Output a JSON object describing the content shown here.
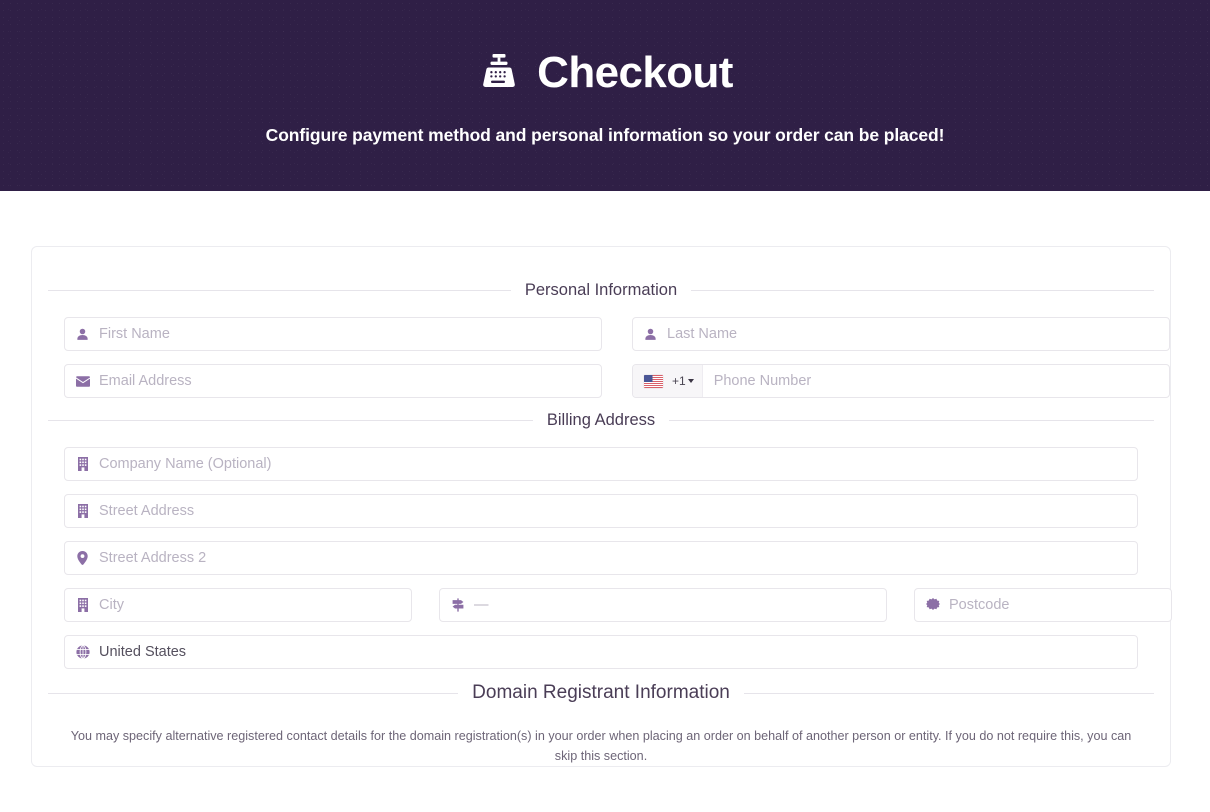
{
  "header": {
    "icon": "cash-register-icon",
    "title": "Checkout",
    "subtitle": "Configure payment method and personal information so your order can be placed!",
    "bg_color": "#2f1f46",
    "text_color": "#ffffff"
  },
  "theme": {
    "icon_color": "#8c6fa6",
    "placeholder_color": "#b9b3c2",
    "value_color": "#55505e",
    "border_color": "#e8e6eb",
    "legend_color": "#4a3d56"
  },
  "sections": {
    "personal_information": {
      "legend": "Personal Information",
      "fields": {
        "first_name": {
          "placeholder": "First Name",
          "icon": "user-icon",
          "value": ""
        },
        "last_name": {
          "placeholder": "Last Name",
          "icon": "user-icon",
          "value": ""
        },
        "email": {
          "placeholder": "Email Address",
          "icon": "envelope-icon",
          "value": ""
        },
        "phone": {
          "placeholder": "Phone Number",
          "icon": "us-flag-icon",
          "dial_code": "+1",
          "country_code": "US",
          "value": ""
        }
      }
    },
    "billing_address": {
      "legend": "Billing Address",
      "fields": {
        "company": {
          "placeholder": "Company Name (Optional)",
          "icon": "building-icon",
          "value": ""
        },
        "street1": {
          "placeholder": "Street Address",
          "icon": "building-icon",
          "value": ""
        },
        "street2": {
          "placeholder": "Street Address 2",
          "icon": "map-pin-icon",
          "value": ""
        },
        "city": {
          "placeholder": "City",
          "icon": "building-icon",
          "value": ""
        },
        "state": {
          "placeholder": "—",
          "icon": "signpost-icon",
          "value": "—"
        },
        "postcode": {
          "placeholder": "Postcode",
          "icon": "certificate-icon",
          "value": ""
        },
        "country": {
          "placeholder": "United States",
          "icon": "globe-icon",
          "value": "United States"
        }
      }
    },
    "domain_registrant": {
      "legend": "Domain Registrant Information",
      "note": "You may specify alternative registered contact details for the domain registration(s) in your order when placing an order on behalf of another person or entity. If you do not require this, you can skip this section."
    }
  }
}
